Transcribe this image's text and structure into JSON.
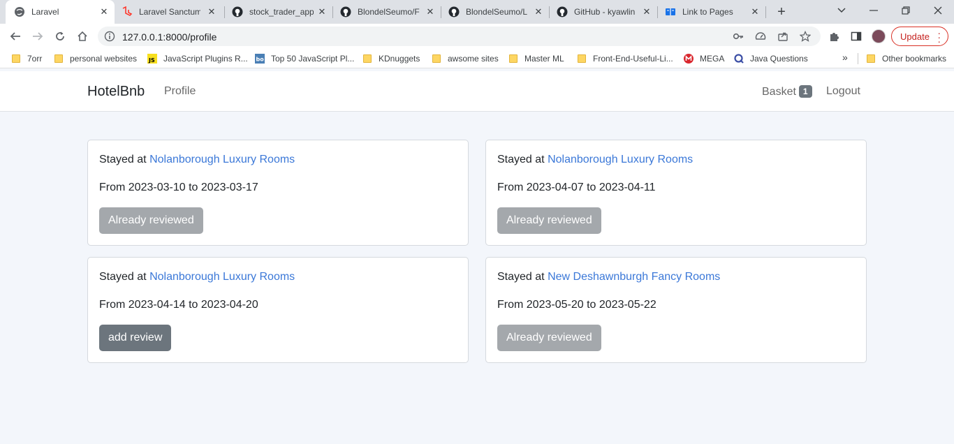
{
  "browser": {
    "tabs": [
      {
        "title": "Laravel",
        "active": true
      },
      {
        "title": "Laravel Sanctum"
      },
      {
        "title": "stock_trader_app"
      },
      {
        "title": "BlondelSeumo/F"
      },
      {
        "title": "BlondelSeumo/L"
      },
      {
        "title": "GitHub - kyawlin"
      },
      {
        "title": "Link to Pages"
      }
    ],
    "url": "127.0.0.1:8000/profile",
    "update_label": "Update",
    "bookmarks": [
      {
        "label": "7orr"
      },
      {
        "label": "personal websites"
      },
      {
        "label": "JavaScript Plugins R..."
      },
      {
        "label": "Top 50 JavaScript Pl..."
      },
      {
        "label": "KDnuggets"
      },
      {
        "label": "awsome sites"
      },
      {
        "label": "Master ML"
      },
      {
        "label": "Front-End-Useful-Li..."
      },
      {
        "label": "MEGA"
      },
      {
        "label": "Java Questions"
      }
    ],
    "more_bookmarks": "»",
    "other_bookmarks": "Other bookmarks"
  },
  "navbar": {
    "brand": "HotelBnb",
    "profile": "Profile",
    "basket": "Basket",
    "basket_count": "1",
    "logout": "Logout"
  },
  "bookings": [
    {
      "prefix": "Stayed at",
      "hotel": "Nolanborough Luxury Rooms",
      "from_label": "From",
      "from": "2023-03-10",
      "to_label": "to",
      "to": "2023-03-17",
      "action": "Already reviewed",
      "reviewed": true
    },
    {
      "prefix": "Stayed at",
      "hotel": "Nolanborough Luxury Rooms",
      "from_label": "From",
      "from": "2023-04-07",
      "to_label": "to",
      "to": "2023-04-11",
      "action": "Already reviewed",
      "reviewed": true
    },
    {
      "prefix": "Stayed at",
      "hotel": "Nolanborough Luxury Rooms",
      "from_label": "From",
      "from": "2023-04-14",
      "to_label": "to",
      "to": "2023-04-20",
      "action": "add review",
      "reviewed": false
    },
    {
      "prefix": "Stayed at",
      "hotel": "New Deshawnburgh Fancy Rooms",
      "from_label": "From",
      "from": "2023-05-20",
      "to_label": "to",
      "to": "2023-05-22",
      "action": "Already reviewed",
      "reviewed": true
    }
  ],
  "colors": {
    "link": "#3b78d8",
    "button_disabled": "#a4a8ac",
    "button_enabled": "#6c757d",
    "page_background": "#f3f6fb"
  }
}
